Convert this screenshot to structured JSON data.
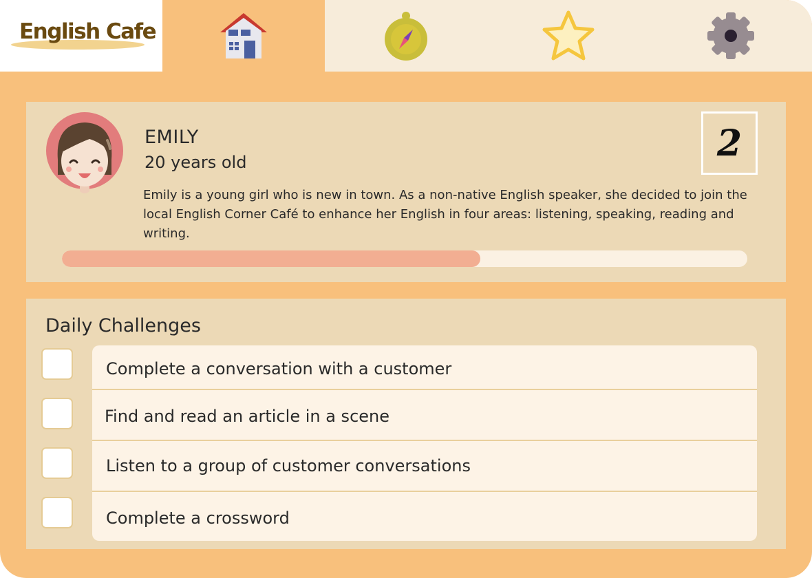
{
  "app": {
    "logo_text": "English Cafe"
  },
  "nav": {
    "tabs": [
      {
        "name": "home",
        "icon": "house-icon",
        "active": true
      },
      {
        "name": "explore",
        "icon": "compass-icon",
        "active": false
      },
      {
        "name": "favorites",
        "icon": "star-icon",
        "active": false
      },
      {
        "name": "settings",
        "icon": "gear-icon",
        "active": false
      }
    ]
  },
  "profile": {
    "name": "EMILY",
    "age": "20 years old",
    "description": "Emily is a young girl who is new in town. As a non-native English speaker, she decided to join the local English Corner Café to enhance her English in four areas: listening, speaking, reading and writing.",
    "level": "2",
    "progress": 0.61,
    "avatar_icon": "girl-avatar-icon"
  },
  "challenges": {
    "title": "Daily Challenges",
    "items": [
      {
        "label": "Complete a conversation with a customer",
        "checked": false
      },
      {
        "label": "Find and read an article in a scene",
        "checked": false
      },
      {
        "label": "Listen to a group of customer conversations",
        "checked": false
      },
      {
        "label": "Complete a crossword",
        "checked": false
      }
    ]
  },
  "colors": {
    "background": "#f8c07c",
    "panel": "#ecd9b6",
    "progress_fill": "#f2ae92",
    "progress_track": "#fbf1e3",
    "logo_text": "#6a4a10"
  }
}
